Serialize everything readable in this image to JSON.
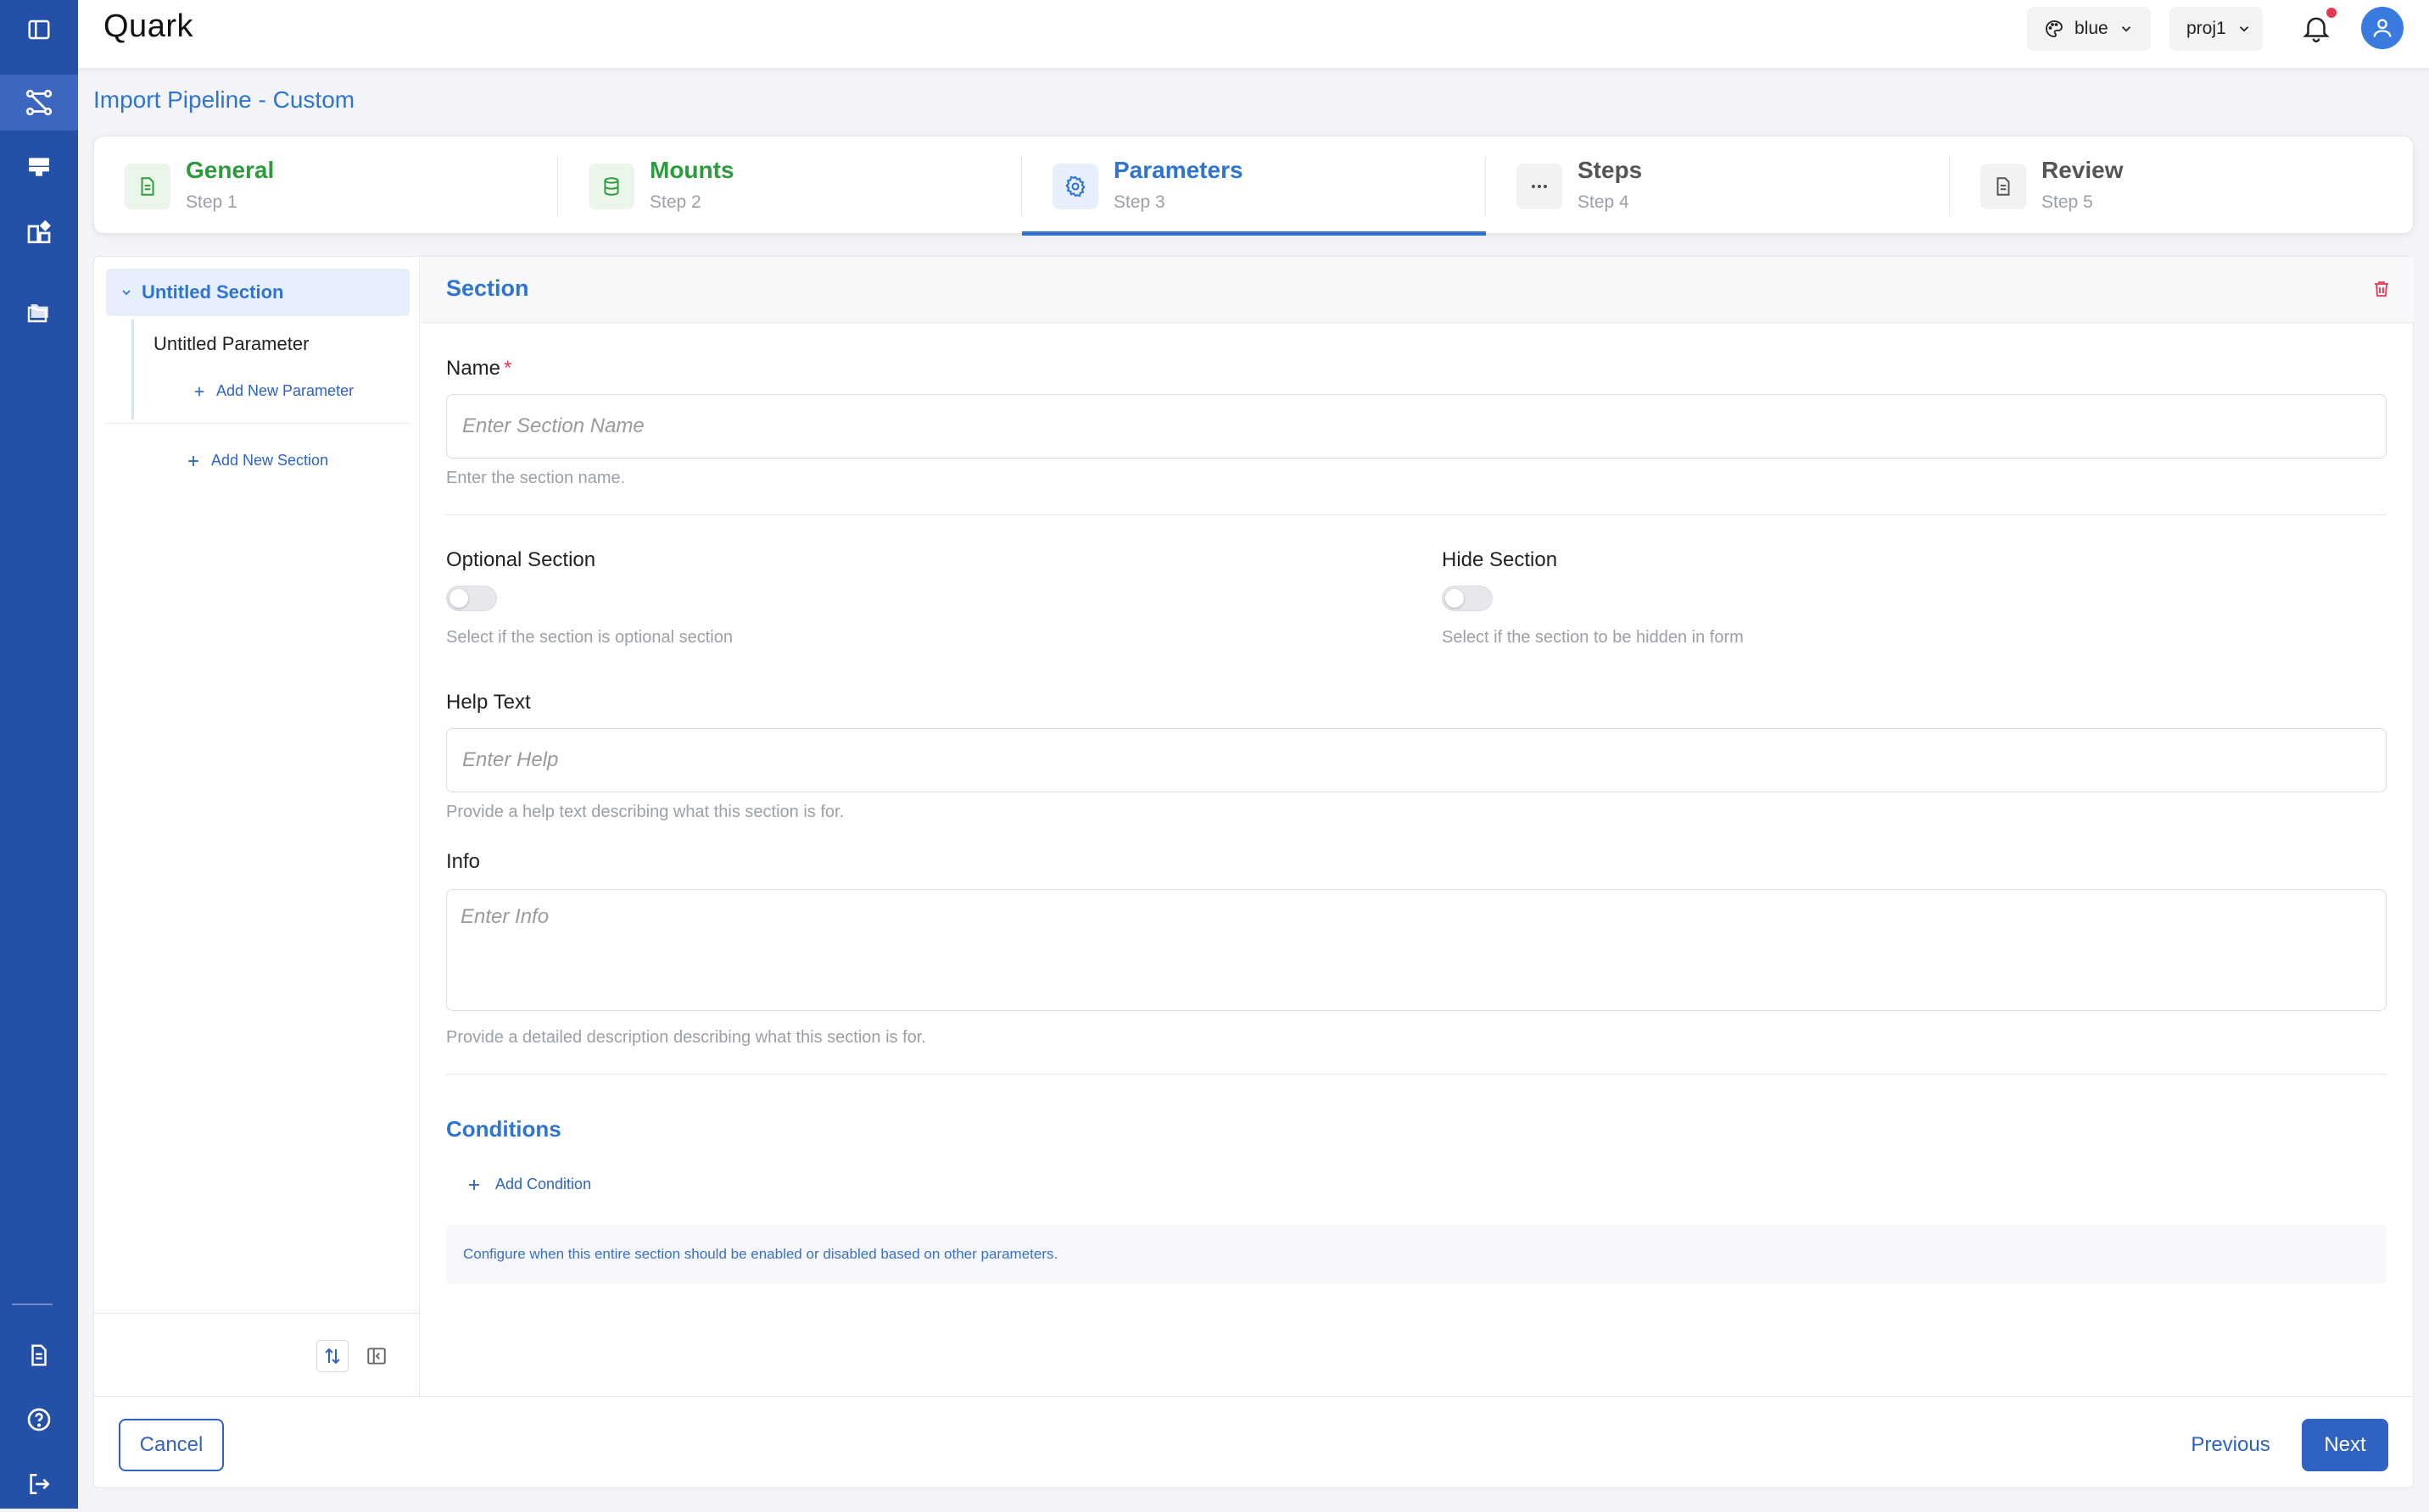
{
  "app": {
    "brand": "Quark"
  },
  "rail": {
    "icons": [
      "sidebar-toggle-icon",
      "pipeline-icon",
      "server-icon",
      "widgets-icon",
      "folders-icon",
      "document-icon",
      "help-icon",
      "logout-icon"
    ],
    "active": "pipeline-icon"
  },
  "topbar": {
    "theme_label": "blue",
    "project_label": "proj1"
  },
  "page": {
    "title": "Import Pipeline - Custom"
  },
  "stepper": {
    "steps": [
      {
        "title": "General",
        "sub": "Step 1",
        "state": "done"
      },
      {
        "title": "Mounts",
        "sub": "Step 2",
        "state": "done"
      },
      {
        "title": "Parameters",
        "sub": "Step 3",
        "state": "active"
      },
      {
        "title": "Steps",
        "sub": "Step 4",
        "state": "pending"
      },
      {
        "title": "Review",
        "sub": "Step 5",
        "state": "pending"
      }
    ]
  },
  "tree": {
    "section_label": "Untitled Section",
    "parameter_label": "Untitled Parameter",
    "add_parameter_label": "Add New Parameter",
    "add_section_label": "Add New Section"
  },
  "form": {
    "header_title": "Section",
    "name_label": "Name",
    "name_required_mark": "*",
    "name_placeholder": "Enter Section Name",
    "name_hint": "Enter the section name.",
    "optional_label": "Optional Section",
    "optional_hint": "Select if the section is optional section",
    "hide_label": "Hide Section",
    "hide_hint": "Select if the section to be hidden in form",
    "help_label": "Help Text",
    "help_placeholder": "Enter Help",
    "help_hint": "Provide a help text describing what this section is for.",
    "info_label": "Info",
    "info_placeholder": "Enter Info",
    "info_hint": "Provide a detailed description describing what this section is for.",
    "conditions_title": "Conditions",
    "add_condition_label": "Add Condition",
    "conditions_info": "Configure when this entire section should be enabled or disabled based on other parameters."
  },
  "footer": {
    "cancel_label": "Cancel",
    "previous_label": "Previous",
    "next_label": "Next"
  },
  "colors": {
    "rail": "#2450a8",
    "accent": "#2f74d0",
    "done": "#2e9a3e",
    "danger": "#e53953"
  }
}
